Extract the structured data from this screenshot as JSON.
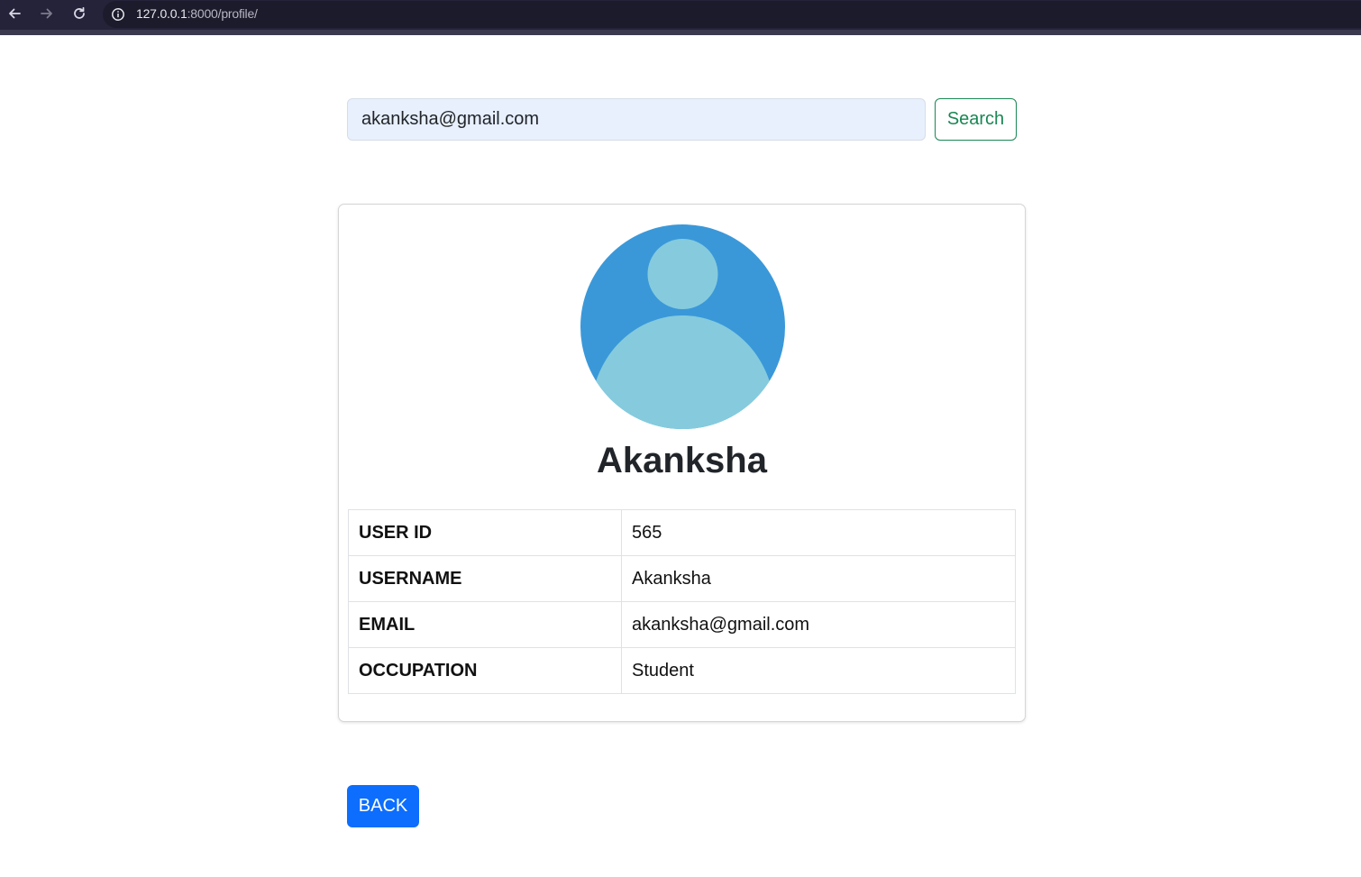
{
  "browser": {
    "url_host": "127.0.0.1",
    "url_path": ":8000/profile/"
  },
  "search": {
    "value": "akanksha@gmail.com",
    "button_label": "Search"
  },
  "profile": {
    "name": "Akanksha",
    "avatar_colors": {
      "background": "#3a98d9",
      "figure": "#85cbdd"
    },
    "rows": [
      {
        "key": "USER ID",
        "value": "565"
      },
      {
        "key": "USERNAME",
        "value": "Akanksha"
      },
      {
        "key": "EMAIL",
        "value": "akanksha@gmail.com"
      },
      {
        "key": "OCCUPATION",
        "value": "Student"
      }
    ]
  },
  "back": {
    "label": "BACK"
  },
  "colors": {
    "primary": "#0d6efd",
    "success": "#198754"
  }
}
